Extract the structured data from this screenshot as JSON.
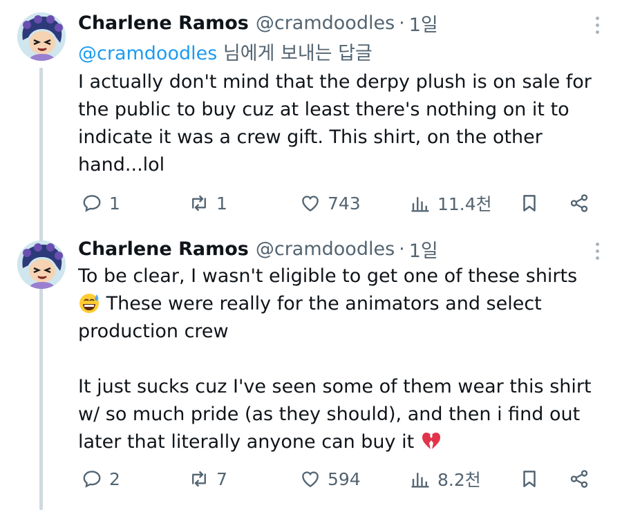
{
  "tweets": [
    {
      "name": "Charlene Ramos",
      "handle": "@cramdoodles",
      "separator": "·",
      "time": "1일",
      "reply_to_mention": "@cramdoodles",
      "reply_to_suffix": "님에게 보내는 답글",
      "lines": [
        "I actually don't mind that the derpy plush is on sale for",
        "the public to buy cuz at least there's nothing on it to",
        "indicate it was a crew gift. This shirt, on the other",
        "hand...lol"
      ],
      "actions": {
        "replies": "1",
        "retweets": "1",
        "likes": "743",
        "views": "11.4천"
      }
    },
    {
      "name": "Charlene Ramos",
      "handle": "@cramdoodles",
      "separator": "·",
      "time": "1일",
      "lines": [
        "To be clear, I wasn't eligible to get one of these shirts",
        "These were really for the animators and select",
        "production crew",
        "",
        "It just sucks cuz I've seen some of them wear this shirt",
        "w/ so much pride (as they should), and then i find out",
        "later that literally anyone can buy it"
      ],
      "emojis": [
        "grinning-sweat-emoji",
        "broken-heart-emoji"
      ],
      "actions": {
        "replies": "2",
        "retweets": "7",
        "likes": "594",
        "views": "8.2천"
      }
    }
  ],
  "colors": {
    "text": "#0f1419",
    "secondary": "#536471",
    "mention": "#1d9bf0",
    "thread_line": "#cfd9de",
    "avatar_bg": "#cfe6ee"
  }
}
